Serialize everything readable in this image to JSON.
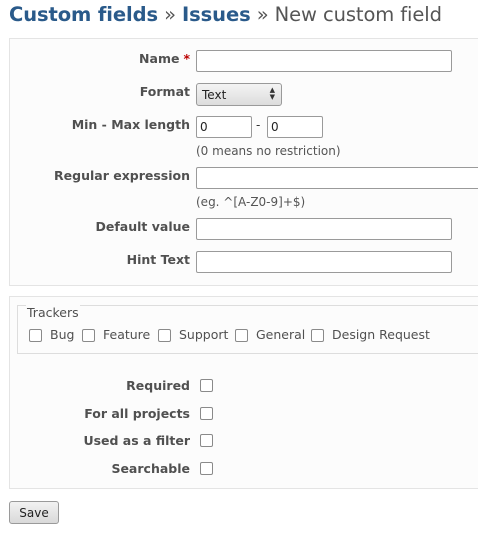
{
  "breadcrumb": {
    "item1": "Custom fields",
    "sep1": " » ",
    "item2": "Issues",
    "sep2": " » ",
    "current": "New custom field"
  },
  "form": {
    "name_label": "Name",
    "required_marker": "*",
    "name_value": "",
    "format_label": "Format",
    "format_selected": "Text",
    "minmax_label": "Min - Max length",
    "min_value": "0",
    "max_value": "0",
    "minmax_dash": "-",
    "minmax_hint": "(0 means no restriction)",
    "regex_label": "Regular expression",
    "regex_value": "",
    "regex_hint": "(eg. ^[A-Z0-9]+$)",
    "default_label": "Default value",
    "default_value": "",
    "hint_label": "Hint Text",
    "hint_value": ""
  },
  "trackers": {
    "legend": "Trackers",
    "items": [
      {
        "label": "Bug",
        "checked": false
      },
      {
        "label": "Feature",
        "checked": false
      },
      {
        "label": "Support",
        "checked": false
      },
      {
        "label": "General",
        "checked": false
      },
      {
        "label": "Design Request",
        "checked": false
      }
    ]
  },
  "options": {
    "required_label": "Required",
    "all_projects_label": "For all projects",
    "filter_label": "Used as a filter",
    "searchable_label": "Searchable"
  },
  "actions": {
    "save_label": "Save"
  }
}
